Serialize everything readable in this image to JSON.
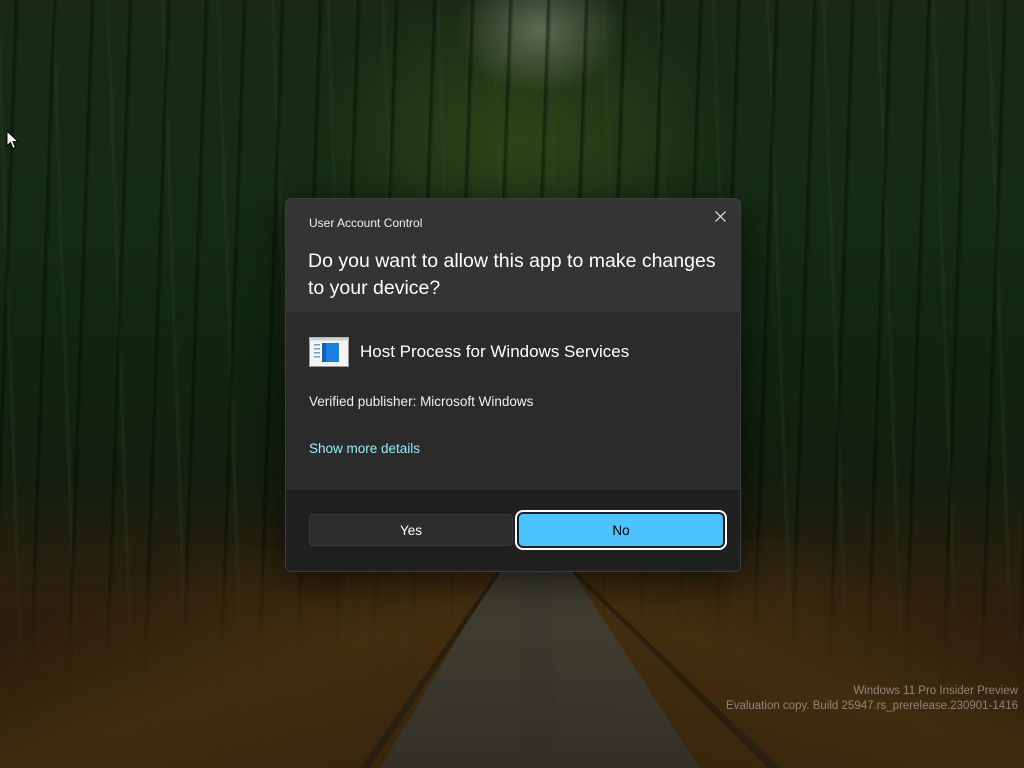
{
  "desktop": {
    "watermark_line1": "Windows 11 Pro Insider Preview",
    "watermark_line2": "Evaluation copy. Build 25947.rs_prerelease.230901-1416"
  },
  "dialog": {
    "caption": "User Account Control",
    "question": "Do you want to allow this app to make changes to your device?",
    "app_name": "Host Process for Windows Services",
    "publisher": "Verified publisher: Microsoft Windows",
    "details_link": "Show more details",
    "yes_label": "Yes",
    "no_label": "No",
    "accent_color": "#4cc2ff",
    "link_color": "#99ebff",
    "icons": {
      "close": "close-icon",
      "app": "app-window-icon"
    }
  }
}
